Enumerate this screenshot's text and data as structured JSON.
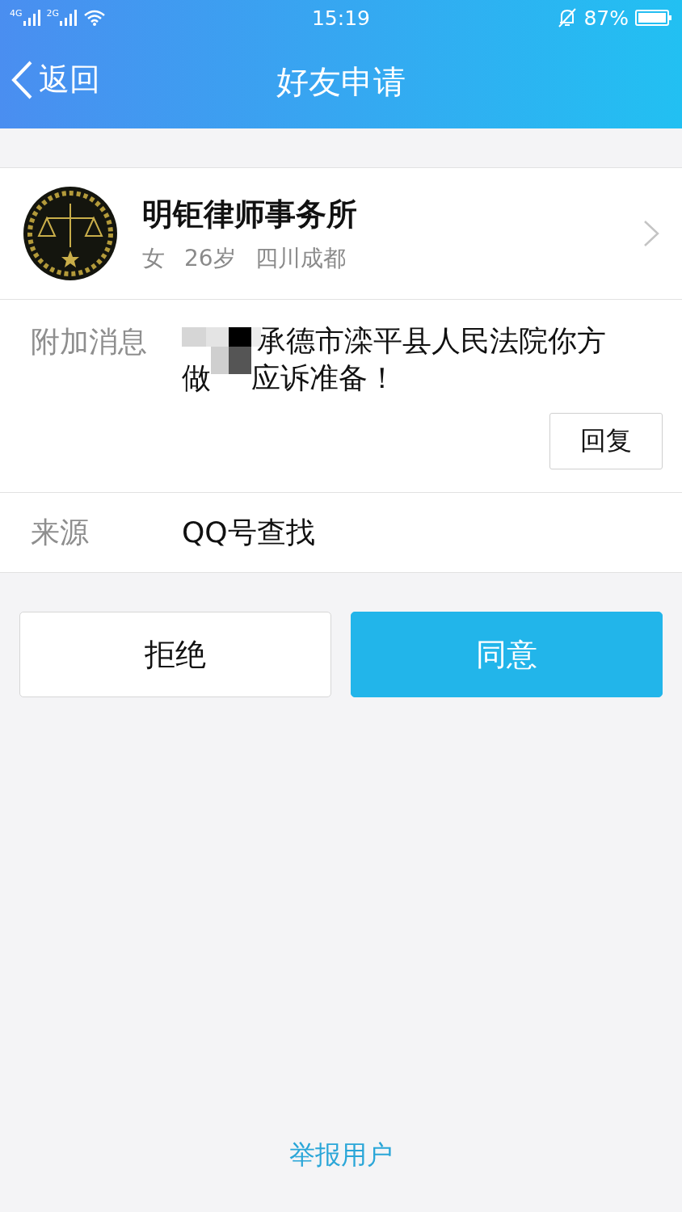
{
  "status_bar": {
    "networks": [
      "4G",
      "2G"
    ],
    "time": "15:19",
    "battery": "87%"
  },
  "nav": {
    "back": "返回",
    "title": "好友申请"
  },
  "profile": {
    "name": "明钜律师事务所",
    "gender": "女",
    "age": "26岁",
    "location": "四川成都"
  },
  "message": {
    "label": "附加消息",
    "line_1": "承德市滦平县人民法院你方",
    "line_2_start": "做",
    "line_2_end": "应诉准备！",
    "reply_button": "回复"
  },
  "source": {
    "label": "来源",
    "value": "QQ号查找"
  },
  "actions": [
    {
      "label": "拒绝",
      "kind": "secondary"
    },
    {
      "label": "同意",
      "kind": "primary"
    }
  ],
  "report_link": "举报用户"
}
